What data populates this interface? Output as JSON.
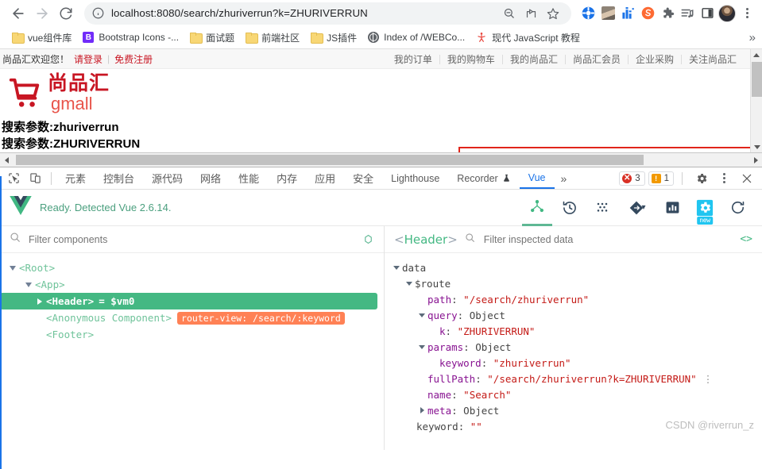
{
  "browser": {
    "nav": {
      "back": "back-arrow",
      "forward": "forward-arrow",
      "reload": "reload"
    },
    "omnibox": {
      "url": "localhost:8080/search/zhuriverrun?k=ZHURIVERRUN",
      "info_icon": "info-circle-icon",
      "actions": [
        "zoom-out-icon",
        "share-icon",
        "bookmark-star-icon"
      ]
    },
    "extensions": [
      "adblock-icon",
      "profile-photo-icon",
      "analytics-icon",
      "sogou-icon",
      "puzzle-extension-icon",
      "playlist-icon",
      "sidepanel-icon"
    ],
    "menu": "browser-menu-icon"
  },
  "bookmarks": {
    "items": [
      {
        "label": "vue组件库",
        "icon": "folder-icon"
      },
      {
        "label": "Bootstrap Icons -...",
        "icon": "bootstrap-icon"
      },
      {
        "label": "面试题",
        "icon": "folder-icon"
      },
      {
        "label": "前端社区",
        "icon": "folder-icon"
      },
      {
        "label": "JS插件",
        "icon": "folder-icon"
      },
      {
        "label": "Index of /WEBCo...",
        "icon": "globe-icon"
      },
      {
        "label": "现代 JavaScript 教程",
        "icon": "javascript-tutorial-icon"
      }
    ],
    "overflow": "»"
  },
  "page": {
    "topbar": {
      "welcome": "尚品汇欢迎您！",
      "login": "请登录",
      "register": "免费注册",
      "right_links": [
        "我的订单",
        "我的购物车",
        "我的尚品汇",
        "尚品汇会员",
        "企业采购",
        "关注尚品汇"
      ]
    },
    "logo": {
      "cn": "尚品汇",
      "en": "gmall",
      "icon": "shopping-cart-icon",
      "color": "#c81623"
    },
    "search_input_value": "",
    "search_input_placeholder": "",
    "params": [
      "搜索参数:zhuriverrun",
      "搜索参数:ZHURIVERRUN"
    ]
  },
  "devtools": {
    "tools": [
      "inspect-element-icon",
      "device-toolbar-icon"
    ],
    "tabs": [
      {
        "label": "元素",
        "active": false
      },
      {
        "label": "控制台",
        "active": false
      },
      {
        "label": "源代码",
        "active": false
      },
      {
        "label": "网络",
        "active": false
      },
      {
        "label": "性能",
        "active": false
      },
      {
        "label": "内存",
        "active": false
      },
      {
        "label": "应用",
        "active": false
      },
      {
        "label": "安全",
        "active": false
      },
      {
        "label": "Lighthouse",
        "active": false
      },
      {
        "label": "Recorder",
        "active": false
      },
      {
        "label": "Vue",
        "active": true
      }
    ],
    "more": "»",
    "errors": "3",
    "warnings": "1",
    "settings_icon": "gear-icon",
    "menu_icon": "more-vertical-icon",
    "close_icon": "close-icon"
  },
  "vue": {
    "logo": "vue-logo-icon",
    "status": "Ready. Detected Vue 2.6.14.",
    "actions": [
      {
        "name": "components-tab",
        "icon": "component-tree-icon",
        "active": true
      },
      {
        "name": "timeline-tab",
        "icon": "history-clock-icon",
        "active": false
      },
      {
        "name": "vuex-tab",
        "icon": "vuex-dots-icon",
        "active": false
      },
      {
        "name": "routing-tab",
        "icon": "router-diamond-icon",
        "active": false
      },
      {
        "name": "performance-tab",
        "icon": "bar-chart-icon",
        "active": false
      },
      {
        "name": "settings-tab",
        "icon": "gear-icon",
        "active": false,
        "badge": "new"
      },
      {
        "name": "refresh-button",
        "icon": "refresh-icon",
        "active": false
      }
    ],
    "components": {
      "filter_placeholder": "Filter components",
      "select_icon": "target-select-icon",
      "tree": [
        {
          "name": "<Root>",
          "depth": 0,
          "arrow": "down",
          "selected": false,
          "suffix": "",
          "tag": ""
        },
        {
          "name": "<App>",
          "depth": 1,
          "arrow": "down",
          "selected": false,
          "suffix": "",
          "tag": ""
        },
        {
          "name": "<Header>",
          "depth": 2,
          "arrow": "right",
          "selected": true,
          "suffix": "= $vm0",
          "tag": ""
        },
        {
          "name": "<Anonymous Component>",
          "depth": 2,
          "arrow": "none",
          "selected": false,
          "suffix": "",
          "tag": "router-view: /search/:keyword"
        },
        {
          "name": "<Footer>",
          "depth": 2,
          "arrow": "none",
          "selected": false,
          "suffix": "",
          "tag": ""
        }
      ]
    },
    "inspector": {
      "component": "<Header>",
      "filter_placeholder": "Filter inspected data",
      "code_icon": "<>",
      "rows": [
        {
          "indent": 0,
          "arrow": "down",
          "key": "data",
          "keyclass": "plain",
          "sep": "",
          "value": "",
          "valclass": "",
          "more": false
        },
        {
          "indent": 1,
          "arrow": "down",
          "key": "$route",
          "keyclass": "plain",
          "sep": "",
          "value": "",
          "valclass": "",
          "more": false
        },
        {
          "indent": 2,
          "arrow": "none",
          "key": "path",
          "keyclass": "key",
          "sep": ":",
          "value": "\"/search/zhuriverrun\"",
          "valclass": "str",
          "more": false
        },
        {
          "indent": 2,
          "arrow": "down",
          "key": "query",
          "keyclass": "key",
          "sep": ":",
          "value": "Object",
          "valclass": "obj",
          "more": false
        },
        {
          "indent": 3,
          "arrow": "none",
          "key": "k",
          "keyclass": "key",
          "sep": ":",
          "value": "\"ZHURIVERRUN\"",
          "valclass": "str",
          "more": false
        },
        {
          "indent": 2,
          "arrow": "down",
          "key": "params",
          "keyclass": "key",
          "sep": ":",
          "value": "Object",
          "valclass": "obj",
          "more": false
        },
        {
          "indent": 3,
          "arrow": "none",
          "key": "keyword",
          "keyclass": "key",
          "sep": ":",
          "value": "\"zhuriverrun\"",
          "valclass": "str",
          "more": false
        },
        {
          "indent": 2,
          "arrow": "none",
          "key": "fullPath",
          "keyclass": "key",
          "sep": ":",
          "value": "\"/search/zhuriverrun?k=ZHURIVERRUN\"",
          "valclass": "str",
          "more": true
        },
        {
          "indent": 2,
          "arrow": "none",
          "key": "name",
          "keyclass": "key",
          "sep": ":",
          "value": "\"Search\"",
          "valclass": "str",
          "more": false
        },
        {
          "indent": 1,
          "arrow": "right",
          "key": "meta",
          "keyclass": "key",
          "sep": ":",
          "value": "Object",
          "valclass": "obj",
          "more": false
        },
        {
          "indent": 1,
          "arrow": "none",
          "key": "keyword",
          "keyclass": "plain",
          "sep": ":",
          "value": "\"\"",
          "valclass": "str",
          "more": false
        }
      ],
      "watermark": "CSDN @riverrun_z"
    }
  }
}
